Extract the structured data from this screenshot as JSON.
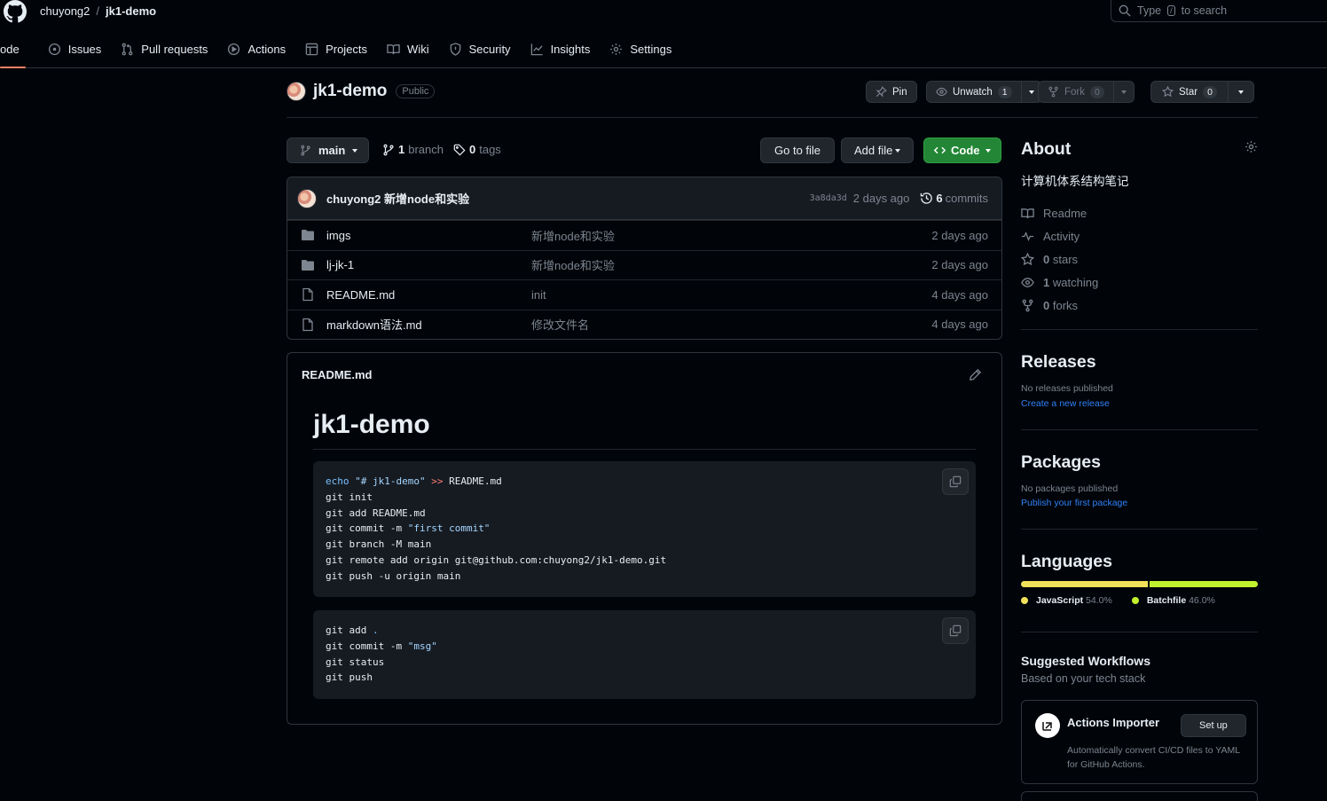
{
  "header": {
    "owner": "chuyong2",
    "separator": "/",
    "repo": "jk1-demo",
    "search_prefix": "Type",
    "search_key": "/",
    "search_suffix": "to search"
  },
  "tabs": [
    {
      "label": "ode"
    },
    {
      "label": "Issues"
    },
    {
      "label": "Pull requests"
    },
    {
      "label": "Actions"
    },
    {
      "label": "Projects"
    },
    {
      "label": "Wiki"
    },
    {
      "label": "Security"
    },
    {
      "label": "Insights"
    },
    {
      "label": "Settings"
    }
  ],
  "repo": {
    "name": "jk1-demo",
    "visibility": "Public",
    "pin_label": "Pin",
    "watch_label": "Unwatch",
    "watch_count": "1",
    "fork_label": "Fork",
    "fork_count": "0",
    "star_label": "Star",
    "star_count": "0"
  },
  "branchbar": {
    "branch": "main",
    "branch_count": "1",
    "branch_word": "branch",
    "tag_count": "0",
    "tag_word": "tags",
    "go_to_file": "Go to file",
    "add_file": "Add file",
    "code": "Code"
  },
  "last_commit": {
    "author": "chuyong2",
    "message": "新增node和实验",
    "sha": "3a8da3d",
    "age": "2 days ago",
    "commit_count": "6",
    "commit_word": "commits"
  },
  "files": [
    {
      "type": "dir",
      "name": "imgs",
      "commit": "新增node和实验",
      "age": "2 days ago"
    },
    {
      "type": "dir",
      "name": "lj-jk-1",
      "commit": "新增node和实验",
      "age": "2 days ago"
    },
    {
      "type": "file",
      "name": "README.md",
      "commit": "init",
      "age": "4 days ago"
    },
    {
      "type": "file",
      "name": "markdown语法.md",
      "commit": "修改文件名",
      "age": "4 days ago"
    }
  ],
  "readme": {
    "filename": "README.md",
    "heading": "jk1-demo",
    "code1": {
      "line1_cmd": "echo",
      "line1_str": "\"# jk1-demo\"",
      "line1_op": ">>",
      "line1_rest": "README.md",
      "line2": "git init",
      "line3": "git add README.md",
      "line4_pre": "git commit -m ",
      "line4_str": "\"first commit\"",
      "line5": "git branch -M main",
      "line6": "git remote add origin git@github.com:chuyong2/jk1-demo.git",
      "line7": "git push -u origin main"
    },
    "code2": {
      "line1_pre": "git add ",
      "line1_dot": ".",
      "line2_pre": "git commit -m ",
      "line2_str": "\"msg\"",
      "line3": "git status",
      "line4": "git push"
    }
  },
  "sidebar": {
    "about_title": "About",
    "description": "计算机体系结构笔记",
    "items": [
      {
        "icon": "book-icon",
        "label": "Readme"
      },
      {
        "icon": "pulse-icon",
        "label": "Activity"
      },
      {
        "icon": "star-icon",
        "count": "0",
        "label": "stars"
      },
      {
        "icon": "eye-icon",
        "count": "1",
        "label": "watching"
      },
      {
        "icon": "fork-icon",
        "count": "0",
        "label": "forks"
      }
    ],
    "releases_title": "Releases",
    "releases_none": "No releases published",
    "releases_link": "Create a new release",
    "packages_title": "Packages",
    "packages_none": "No packages published",
    "packages_link": "Publish your first package",
    "languages_title": "Languages",
    "languages": [
      {
        "name": "JavaScript",
        "percent": "54.0%",
        "value": 54.0,
        "color": "#f1e05a"
      },
      {
        "name": "Batchfile",
        "percent": "46.0%",
        "value": 46.0,
        "color": "#c1f12e"
      }
    ],
    "workflows_title": "Suggested Workflows",
    "workflows_subtitle": "Based on your tech stack",
    "workflow": {
      "title": "Actions Importer",
      "button": "Set up",
      "description": "Automatically convert CI/CD files to YAML for GitHub Actions."
    }
  },
  "colors": {
    "accent_green": "#238636",
    "link_blue": "#2f81f7",
    "tab_underline": "#f78166"
  }
}
